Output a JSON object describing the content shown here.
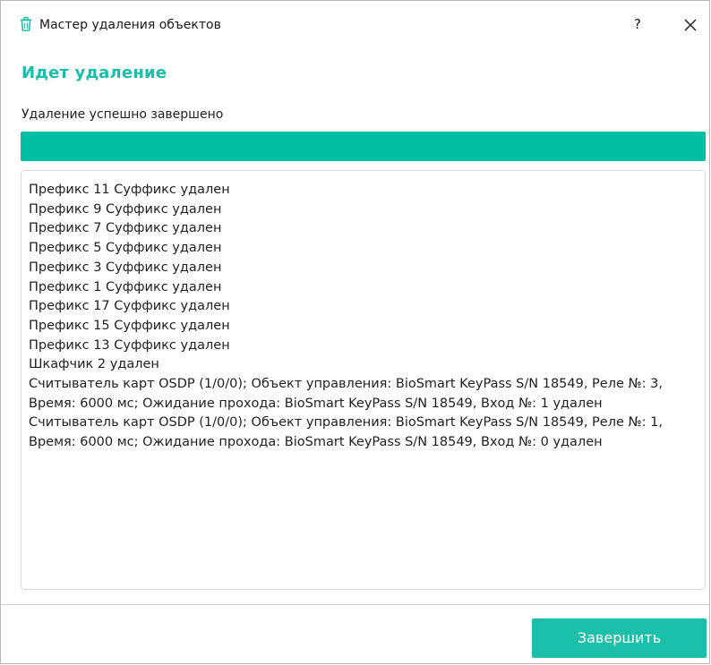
{
  "window": {
    "title": "Мастер удаления объектов",
    "help_label": "?"
  },
  "main": {
    "heading": "Идет удаление",
    "status": "Удаление успешно завершено",
    "progress_fraction": 1.0,
    "log_lines": [
      "Префикс 11 Суффикс удален",
      "Префикс 9 Суффикс удален",
      "Префикс 7 Суффикс удален",
      "Префикс 5 Суффикс удален",
      "Префикс 3 Суффикс удален",
      "Префикс 1 Суффикс удален",
      "Префикс 17 Суффикс удален",
      "Префикс 15 Суффикс удален",
      "Префикс 13 Суффикс удален",
      "Шкафчик 2 удален",
      "Считыватель карт OSDP (1/0/0); Объект управления: BioSmart KeyPass S/N 18549, Реле №: 3, Время: 6000 мс; Ожидание прохода: BioSmart KeyPass S/N 18549, Вход №: 1 удален",
      "Считыватель карт OSDP (1/0/0); Объект управления: BioSmart KeyPass S/N 18549, Реле №: 1, Время: 6000 мс; Ожидание прохода: BioSmart KeyPass S/N 18549, Вход №: 0 удален"
    ]
  },
  "footer": {
    "finish_label": "Завершить"
  },
  "colors": {
    "accent": "#1cc0aa",
    "progress_fill": "#00bfa5"
  },
  "icons": {
    "title_icon": "trash-icon",
    "close_icon": "close-icon"
  }
}
